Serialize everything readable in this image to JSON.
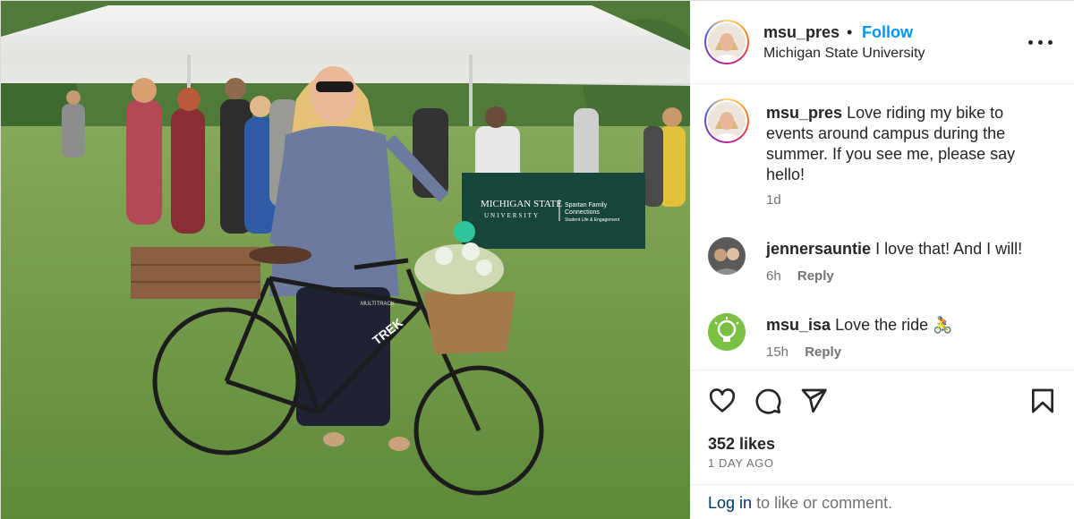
{
  "post": {
    "photo": {
      "banner_title": "MICHIGAN STATE",
      "banner_subtitle": "UNIVERSITY",
      "banner_right_line1": "Spartan Family",
      "banner_right_line2": "Connections",
      "banner_right_line3": "Student Life & Engagement",
      "bike_brand": "TREK",
      "bike_model": "MULTITRACK"
    },
    "header": {
      "username": "msu_pres",
      "separator": "•",
      "follow_label": "Follow",
      "location": "Michigan State University"
    },
    "caption": {
      "username": "msu_pres",
      "text": "Love riding my bike to events around campus during the summer. If you see me, please say hello!",
      "time": "1d"
    },
    "comments": [
      {
        "username": "jennersauntie",
        "text": "I love that! And I will!",
        "time": "6h",
        "reply_label": "Reply"
      },
      {
        "username": "msu_isa",
        "text": "Love the ride 🚴",
        "time": "15h",
        "reply_label": "Reply"
      }
    ],
    "actions": {
      "likes": "352 likes",
      "timestamp": "1 DAY AGO"
    },
    "login": {
      "link_label": "Log in",
      "rest_text": "to like or comment."
    }
  },
  "icons": [
    "heart-icon",
    "comment-icon",
    "share-icon",
    "bookmark-icon",
    "more-icon"
  ],
  "colors": {
    "follow": "#0095f6",
    "meta": "#737373",
    "login_link": "#00376b",
    "msu_green": "#18453b"
  }
}
